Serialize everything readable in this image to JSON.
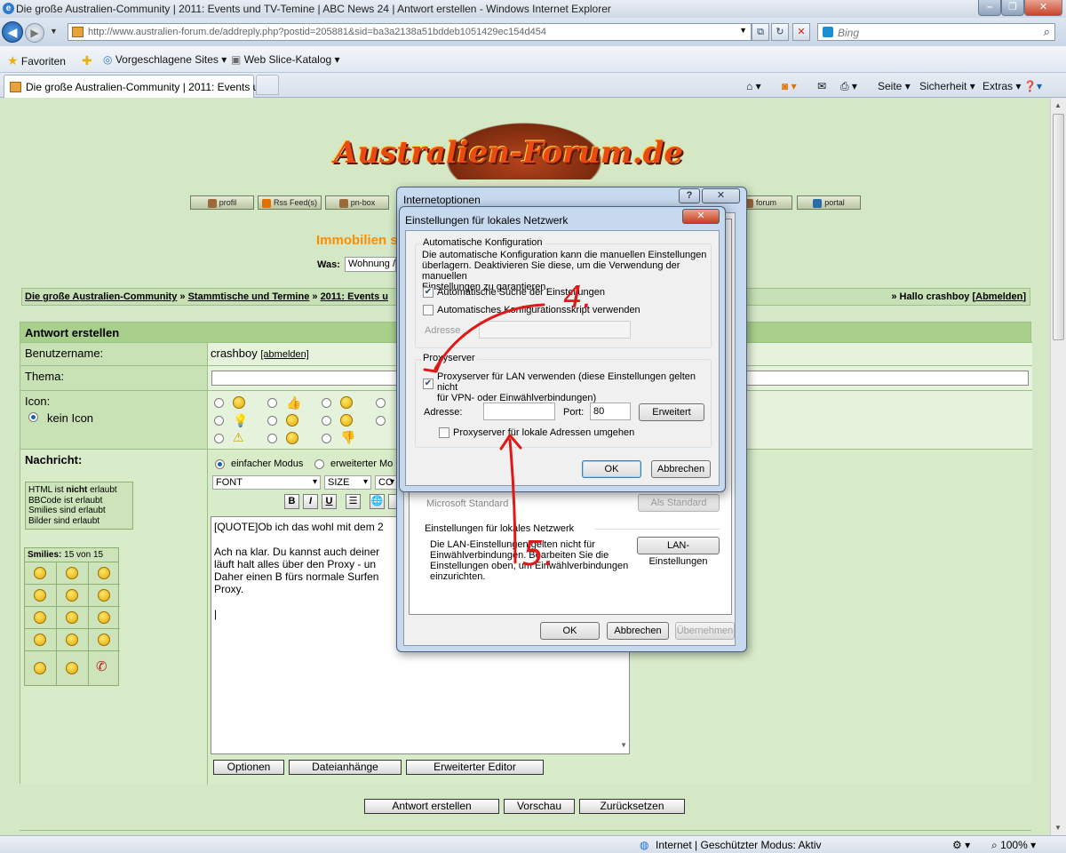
{
  "window": {
    "title": "Die große Australien-Community | 2011: Events und TV-Temine | ABC News 24 | Antwort erstellen - Windows Internet Explorer",
    "url": "http://www.australien-forum.de/addreply.php?postid=205881&sid=ba3a2138a51bddeb1051429ec154d454",
    "search_placeholder": "Bing"
  },
  "favbar": {
    "favorites": "Favoriten",
    "suggested": "Vorgeschlagene Sites",
    "webslice": "Web Slice-Katalog"
  },
  "tab": {
    "label": "Die große Australien-Community | 2011: Events u..."
  },
  "commandbar": {
    "page": "Seite",
    "security": "Sicherheit",
    "extras": "Extras"
  },
  "site": {
    "logo_text": "Australien-Forum.de",
    "nav": [
      "profil",
      "Rss Feed(s)",
      "pn-box",
      "forum",
      "portal"
    ],
    "immo_title": "Immobilien s",
    "immo_was": "Was:",
    "immo_input": "Wohnung /",
    "breadcrumb": [
      "Die große Australien-Community",
      "Stammtische und Termine",
      "2011: Events u"
    ],
    "breadcrumb_sep": "»",
    "hello": "» Hallo crashboy [",
    "logout": "Abmelden",
    "hello_end": "]"
  },
  "form": {
    "header": "Antwort erstellen",
    "username_label": "Benutzername:",
    "username": "crashboy",
    "abmelden": "[abmelden]",
    "thema_label": "Thema:",
    "icon_label": "Icon:",
    "kein_icon": "kein Icon",
    "nachricht_label": "Nachricht:",
    "mode_simple": "einfacher Modus",
    "mode_ext": "erweiterter Mo",
    "info": [
      "HTML ist",
      "nicht",
      "erlaubt",
      "BBCode ist erlaubt",
      "Smilies sind erlaubt",
      "Bilder sind erlaubt"
    ],
    "smilies_label": "Smilies:",
    "smilies_count": "15 von 15",
    "font_select": "FONT",
    "size_select": "SIZE",
    "color_select": "CO",
    "fmt": [
      "B",
      "I",
      "U"
    ],
    "text_lines": [
      "[QUOTE]Ob ich das wohl mit dem 2",
      "",
      "Ach na klar. Du kannst auch deiner",
      "läuft halt alles über den Proxy - un",
      "Daher einen B fürs normale Surfen",
      "Proxy.",
      "",
      "|"
    ],
    "btn_options": "Optionen",
    "btn_attachments": "Dateianhänge",
    "btn_editor": "Erweiterter Editor",
    "btn_submit": "Antwort erstellen",
    "btn_preview": "Vorschau",
    "btn_reset": "Zurücksetzen"
  },
  "status": {
    "zone": "Internet | Geschützter Modus: Aktiv",
    "zoom": "100%"
  },
  "dialog_outer": {
    "title": "Internetoptionen",
    "lan_group": "Einstellungen für lokales Netzwerk",
    "lan_text": [
      "Die LAN-Einstellungen gelten nicht für",
      "Einwählverbindungen. Bearbeiten Sie die",
      "Einstellungen oben, um Einwählverbindungen",
      "einzurichten."
    ],
    "lan_btn": "LAN-Einstellungen",
    "ghost_row": "Microsoft Standard",
    "ghost_btn": "Als Standard",
    "ok": "OK",
    "cancel": "Abbrechen",
    "apply": "Übernehmen"
  },
  "dialog_inner": {
    "title": "Einstellungen für lokales Netzwerk",
    "auto_group": "Automatische Konfiguration",
    "auto_text": [
      "Die automatische Konfiguration kann die manuellen Einstellungen",
      "überlagern. Deaktivieren Sie diese, um die Verwendung der manuellen",
      "Einstellungen zu garantieren."
    ],
    "auto_detect": "Automatische Suche der Einstellungen",
    "auto_script": "Automatisches Konfigurationsskript verwenden",
    "address_label": "Adresse",
    "proxy_group": "Proxyserver",
    "proxy_use": [
      "Proxyserver für LAN verwenden (diese Einstellungen gelten nicht",
      "für VPN- oder Einwählverbindungen)"
    ],
    "proxy_address_label": "Adresse:",
    "proxy_address": "",
    "port_label": "Port:",
    "port": "80",
    "advanced_btn": "Erweitert",
    "bypass_local": "Proxyserver für lokale Adressen umgehen",
    "ok": "OK",
    "cancel": "Abbrechen"
  },
  "annotations": {
    "step4": "4.",
    "step5": "5."
  },
  "colors": {
    "page_bg": "#d4e8c6",
    "header_bg": "#a9cf8c",
    "logo": "#e84a12",
    "annotation": "#e01818",
    "immo": "#ff8c00"
  }
}
